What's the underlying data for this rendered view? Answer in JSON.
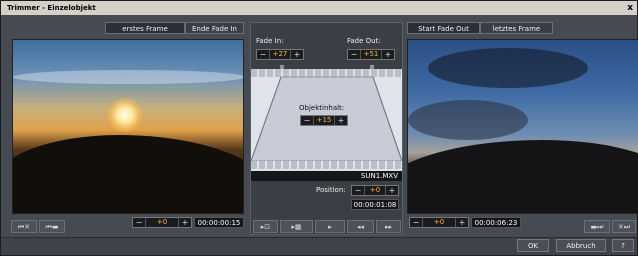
{
  "window": {
    "title": "Trimmer - Einzelobjekt",
    "close": "x"
  },
  "left_tabs": [
    "erstes Frame",
    "Ende Fade In"
  ],
  "right_tabs": [
    "Start Fade Out",
    "letztes Frame"
  ],
  "fade_in": {
    "label": "Fade In:",
    "value": "+27",
    "minus": "−",
    "plus": "+"
  },
  "fade_out": {
    "label": "Fade Out:",
    "value": "+51",
    "minus": "−",
    "plus": "+"
  },
  "object_content": {
    "label": "Objektinhalt:",
    "value": "+15",
    "minus": "−",
    "plus": "+"
  },
  "clip_name": "SUN1.MXV",
  "position": {
    "label": "Position:",
    "value": "+0",
    "minus": "−",
    "plus": "+",
    "timecode": "00:00:01:08"
  },
  "left_controls": {
    "value": "+0",
    "minus": "−",
    "plus": "+",
    "timecode": "00:00:00:15",
    "btn1": "⏮✕",
    "btn2": "⏮▬"
  },
  "right_controls": {
    "value": "+0",
    "minus": "−",
    "plus": "+",
    "timecode": "00:00:06:23",
    "btn1": "▬⏭",
    "btn2": "✕⏭"
  },
  "transport": {
    "b1": "▸⊡",
    "b2": "▸▦",
    "b3": "▸",
    "b4": "◂◂",
    "b5": "▸▸"
  },
  "footer": {
    "ok": "OK",
    "cancel": "Abbruch",
    "help": "?"
  }
}
